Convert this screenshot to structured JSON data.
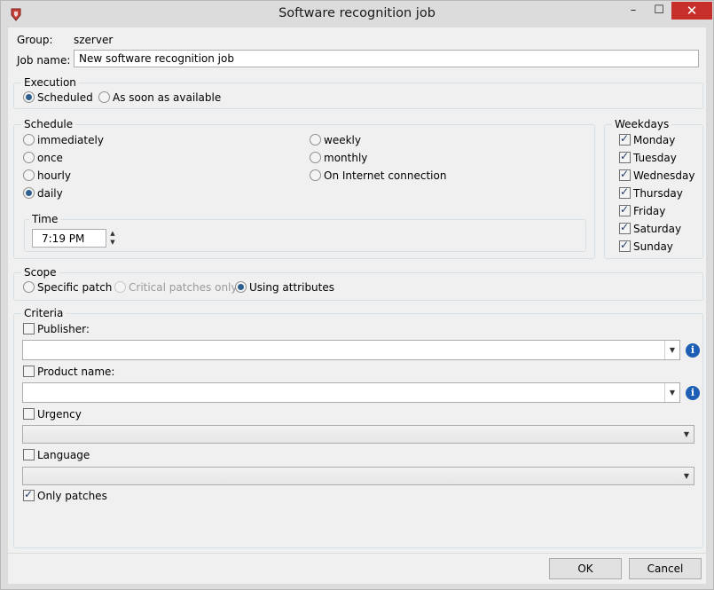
{
  "window": {
    "title": "Software recognition job"
  },
  "fields": {
    "group_label": "Group:",
    "group_value": "szerver",
    "job_name_label": "Job name:",
    "job_name_value": "New software recognition job"
  },
  "execution": {
    "legend": "Execution",
    "options": [
      {
        "label": "Scheduled",
        "selected": true
      },
      {
        "label": "As soon as available",
        "selected": false
      }
    ]
  },
  "schedule": {
    "legend": "Schedule",
    "options": [
      {
        "label": "immediately",
        "selected": false
      },
      {
        "label": "once",
        "selected": false
      },
      {
        "label": "hourly",
        "selected": false
      },
      {
        "label": "daily",
        "selected": true
      },
      {
        "label": "weekly",
        "selected": false
      },
      {
        "label": "monthly",
        "selected": false
      },
      {
        "label": "On Internet connection",
        "selected": false
      }
    ],
    "time_legend": "Time",
    "time_value": "7:19 PM"
  },
  "weekdays": {
    "legend": "Weekdays",
    "days": [
      {
        "label": "Monday",
        "checked": true
      },
      {
        "label": "Tuesday",
        "checked": true
      },
      {
        "label": "Wednesday",
        "checked": true
      },
      {
        "label": "Thursday",
        "checked": true
      },
      {
        "label": "Friday",
        "checked": true
      },
      {
        "label": "Saturday",
        "checked": true
      },
      {
        "label": "Sunday",
        "checked": true
      }
    ]
  },
  "scope": {
    "legend": "Scope",
    "options": [
      {
        "label": "Specific patch",
        "selected": false,
        "enabled": true
      },
      {
        "label": "Critical patches only",
        "selected": false,
        "enabled": false
      },
      {
        "label": "Using attributes",
        "selected": true,
        "enabled": true
      }
    ]
  },
  "criteria": {
    "legend": "Criteria",
    "publisher_label": "Publisher:",
    "publisher_checked": false,
    "publisher_value": "",
    "product_label": "Product name:",
    "product_checked": false,
    "product_value": "",
    "urgency_label": "Urgency",
    "urgency_checked": false,
    "urgency_value": "",
    "language_label": "Language",
    "language_checked": false,
    "language_value": "",
    "only_patches_label": "Only patches",
    "only_patches_checked": true
  },
  "buttons": {
    "ok": "OK",
    "cancel": "Cancel"
  },
  "icons": {
    "app": "app-icon",
    "minimize": "minimize-icon",
    "maximize": "maximize-icon",
    "close": "close-icon",
    "info": "info-icon",
    "dropdown": "chevron-down-icon"
  },
  "colors": {
    "close_button": "#c7302a",
    "info_icon": "#1c5fb4",
    "radio_dot": "#2d5e90"
  }
}
